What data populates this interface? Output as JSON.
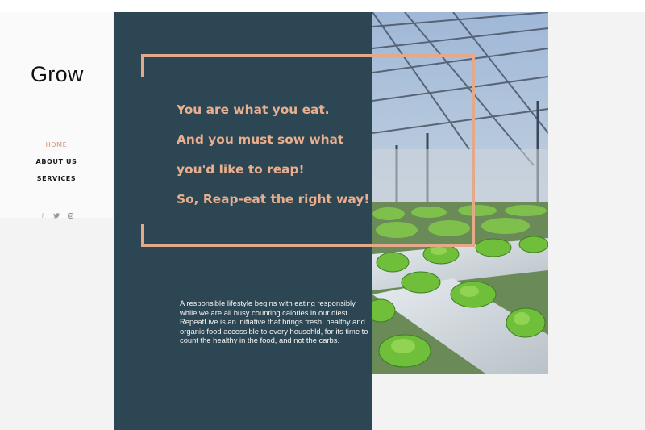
{
  "brand": {
    "logo": "Grow"
  },
  "nav": {
    "items": [
      {
        "label": "HOME",
        "active": true
      },
      {
        "label": "ABOUT US",
        "active": false
      },
      {
        "label": "SERVICES",
        "active": false
      }
    ]
  },
  "social": {
    "icons": [
      {
        "name": "facebook-icon",
        "glyph": "f"
      },
      {
        "name": "twitter-icon",
        "glyph": "🐦︎"
      },
      {
        "name": "instagram-icon",
        "glyph": "◎"
      }
    ]
  },
  "hero": {
    "quote_lines": [
      "You are what you eat.",
      "And you must sow what",
      "you'd like to reap!",
      "So, Reap-eat the right way!"
    ],
    "body": "A responsible lifestyle begins with eating responsibly. while we are all busy counting calories in our diest. RepeatLive is an initiative that brings fresh, healthy and organic food accessible to every househld, for its time to count the healthy in the food, and not the carbs."
  },
  "colors": {
    "panel": "#2d4653",
    "accent": "#e3a98a",
    "nav_active": "#d2926f",
    "page_bg": "#f3f3f3"
  }
}
